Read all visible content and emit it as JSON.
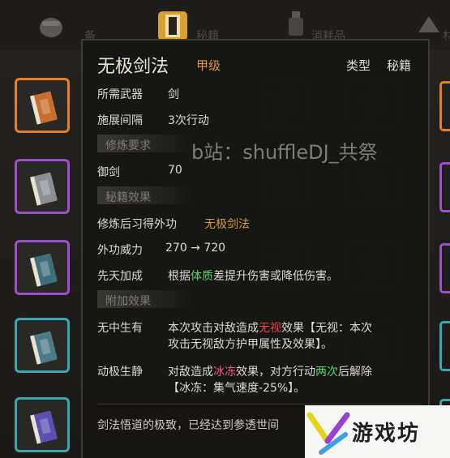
{
  "tabs": [
    {
      "label": "备",
      "icon": "bag-icon"
    },
    {
      "label": "秘籍",
      "icon": "scroll-icon"
    },
    {
      "label": "消耗品",
      "icon": "potion-icon"
    },
    {
      "label": "材",
      "icon": "material-icon"
    }
  ],
  "left_items": [
    {
      "frame_color": "#e0802a",
      "book_color": "#c86e2e",
      "icon": "book-icon"
    },
    {
      "frame_color": "#a04fc8",
      "book_color": "#8b8f94",
      "icon": "book-icon"
    },
    {
      "frame_color": "#a04fc8",
      "book_color": "#3f6f7a",
      "icon": "book-icon"
    },
    {
      "frame_color": "#3aa6b0",
      "book_color": "#4c7a86",
      "icon": "book-icon"
    },
    {
      "frame_color": "#3aa6b0",
      "book_color": "#5b4fb0",
      "icon": "book-icon"
    }
  ],
  "right_items": [
    {
      "frame_color": "#e0802a"
    },
    {
      "frame_color": "#a04fc8"
    },
    {
      "frame_color": "#a04fc8"
    },
    {
      "frame_color": "#3aa6b0"
    },
    {
      "frame_color": "#3aa6b0"
    }
  ],
  "tooltip": {
    "name": "无极剑法",
    "grade": "甲级",
    "type_label": "类型",
    "type_value": "秘籍",
    "weapon_label": "所需武器",
    "weapon_value": "剑",
    "interval_label": "施展间隔",
    "interval_value": "3次行动",
    "sec_requirement": "修炼要求",
    "req_label": "御剑",
    "req_value": "70",
    "sec_effect": "秘籍效果",
    "learn_label": "修炼后习得外功",
    "learn_value": "无极剑法",
    "power_label": "外功威力",
    "power_value": "270 → 720",
    "innate_label": "先天加成",
    "innate_pre": "根据",
    "innate_keyword": "体质",
    "innate_post": "差提升伤害或降低伤害。",
    "sec_extra": "附加效果",
    "effect1_label": "无中生有",
    "effect1_line1_pre": "本次攻击对敌造成",
    "effect1_line1_keyword": "无视",
    "effect1_line1_post": "效果【无视：本次",
    "effect1_line2": "攻击无视敌方护甲属性及效果】。",
    "effect2_label": "动极生静",
    "effect2_line1_pre": "对敌造成",
    "effect2_line1_keyword": "冰冻",
    "effect2_line1_mid": "效果，对方行动",
    "effect2_line1_keyword2": "两次",
    "effect2_line1_post": "后解除",
    "effect2_line2": "【冰冻：集气速度-25%】。",
    "flavor": "剑法悟道的极致，已经达到参透世间"
  },
  "watermark": "b站：shuffleDJ_共祭",
  "logo": {
    "text": "游戏坊",
    "colors": [
      "#e8d21a",
      "#9b3fd0",
      "#3fa0e0"
    ]
  }
}
